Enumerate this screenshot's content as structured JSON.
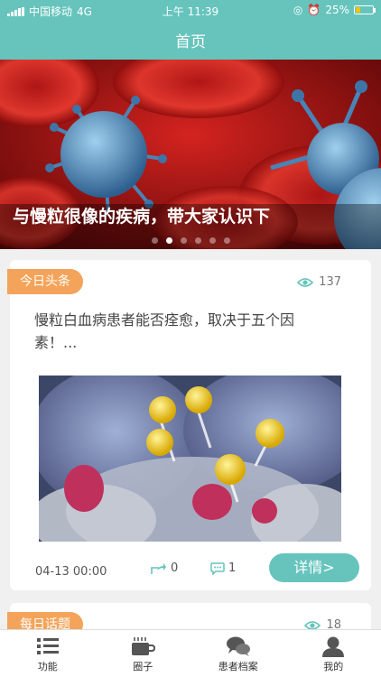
{
  "status_bar": {
    "carrier": "中国移动",
    "network": "4G",
    "time": "上午 11:39",
    "battery": "25%",
    "battery_level": 0.25
  },
  "header": {
    "title": "首页"
  },
  "banner": {
    "caption": "与慢粒很像的疾病，带大家认识下",
    "dot_count": 6,
    "active_dot": 1
  },
  "cards": [
    {
      "tag": "今日头条",
      "views": "137",
      "headline": "慢粒白血病患者能否痊愈，取决于五个因素！...",
      "date": "04-13 00:00",
      "shares": "0",
      "comments": "1",
      "detail_label": "详情>"
    },
    {
      "tag": "每日话题",
      "views": "18"
    }
  ],
  "tabbar": {
    "items": [
      {
        "label": "功能"
      },
      {
        "label": "圈子"
      },
      {
        "label": "患者档案"
      },
      {
        "label": "我的"
      }
    ]
  },
  "colors": {
    "accent": "#66c4bd",
    "tag": "#f4a45a"
  }
}
